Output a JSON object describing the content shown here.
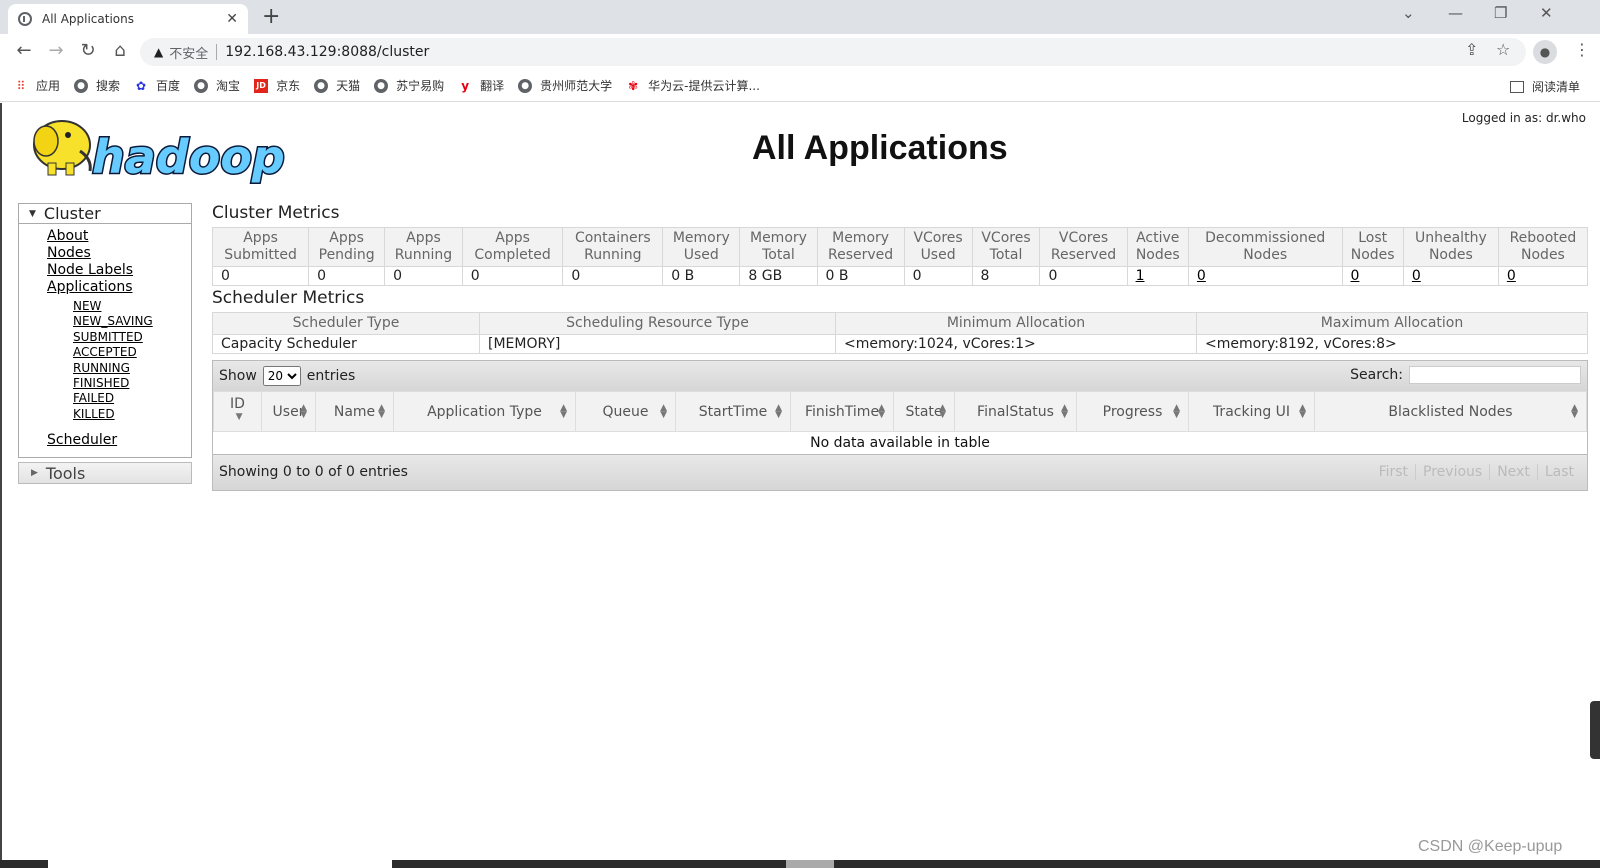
{
  "browser": {
    "tab_title": "All Applications",
    "tab_close": "✕",
    "new_tab": "+",
    "url_insecure": "不安全",
    "url": "192.168.43.129:8088/cluster",
    "bookmarks": [
      {
        "label": "应用",
        "icon": "apps-grid-icon"
      },
      {
        "label": "搜索",
        "icon": "globe-icon"
      },
      {
        "label": "百度",
        "icon": "baidu-icon"
      },
      {
        "label": "淘宝",
        "icon": "globe-icon"
      },
      {
        "label": "京东",
        "icon": "jd-icon"
      },
      {
        "label": "天猫",
        "icon": "globe-icon"
      },
      {
        "label": "苏宁易购",
        "icon": "globe-icon"
      },
      {
        "label": "翻译",
        "icon": "youdao-icon"
      },
      {
        "label": "贵州师范大学",
        "icon": "globe-icon"
      },
      {
        "label": "华为云-提供云计算...",
        "icon": "huawei-icon"
      }
    ],
    "reading_list": "阅读清单"
  },
  "page": {
    "logged_in": "Logged in as: dr.who",
    "title": "All Applications",
    "logo_text": "hadoop"
  },
  "sidebar": {
    "cluster_label": "Cluster",
    "links": [
      "About",
      "Nodes",
      "Node Labels",
      "Applications"
    ],
    "states": [
      "NEW",
      "NEW_SAVING",
      "SUBMITTED",
      "ACCEPTED",
      "RUNNING",
      "FINISHED",
      "FAILED",
      "KILLED"
    ],
    "scheduler": "Scheduler",
    "tools_label": "Tools"
  },
  "cluster_metrics": {
    "title": "Cluster Metrics",
    "headers": [
      [
        "Apps",
        "Submitted"
      ],
      [
        "Apps",
        "Pending"
      ],
      [
        "Apps",
        "Running"
      ],
      [
        "Apps",
        "Completed"
      ],
      [
        "Containers",
        "Running"
      ],
      [
        "Memory",
        "Used"
      ],
      [
        "Memory",
        "Total"
      ],
      [
        "Memory",
        "Reserved"
      ],
      [
        "VCores",
        "Used"
      ],
      [
        "VCores",
        "Total"
      ],
      [
        "VCores",
        "Reserved"
      ],
      [
        "Active",
        "Nodes"
      ],
      [
        "Decommissioned",
        "Nodes"
      ],
      [
        "Lost",
        "Nodes"
      ],
      [
        "Unhealthy",
        "Nodes"
      ],
      [
        "Rebooted",
        "Nodes"
      ]
    ],
    "values": [
      "0",
      "0",
      "0",
      "0",
      "0",
      "0 B",
      "8 GB",
      "0 B",
      "0",
      "8",
      "0",
      "1",
      "0",
      "0",
      "0",
      "0"
    ]
  },
  "scheduler_metrics": {
    "title": "Scheduler Metrics",
    "headers": [
      "Scheduler Type",
      "Scheduling Resource Type",
      "Minimum Allocation",
      "Maximum Allocation"
    ],
    "values": [
      "Capacity Scheduler",
      "[MEMORY]",
      "<memory:1024, vCores:1>",
      "<memory:8192, vCores:8>"
    ]
  },
  "apps_table": {
    "show_label": "Show",
    "entries_label": "entries",
    "page_size": "20",
    "search_label": "Search:",
    "columns": [
      "ID",
      "User",
      "Name",
      "Application Type",
      "Queue",
      "StartTime",
      "FinishTime",
      "State",
      "FinalStatus",
      "Progress",
      "Tracking UI",
      "Blacklisted Nodes"
    ],
    "empty_message": "No data available in table",
    "info": "Showing 0 to 0 of 0 entries",
    "pager": [
      "First",
      "Previous",
      "Next",
      "Last"
    ]
  },
  "watermark": "CSDN @Keep-upup"
}
